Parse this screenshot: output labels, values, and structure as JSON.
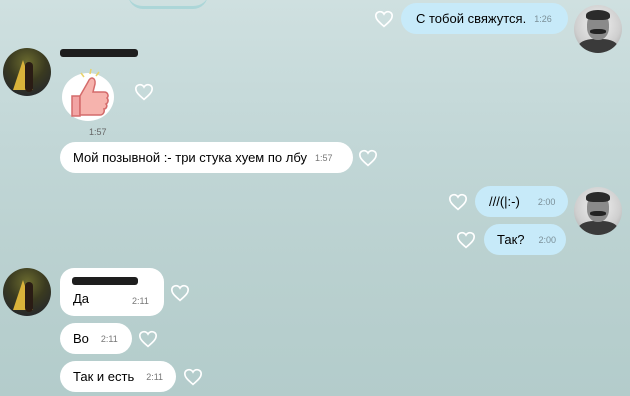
{
  "chat": {
    "messages": [
      {
        "text": "С тобой свяжутся.",
        "time": "1:26"
      },
      {
        "time": "1:57"
      },
      {
        "text": "Мой позывной :- три стука хуем по лбу",
        "time": "1:57"
      },
      {
        "text": "///(|:-)",
        "time": "2:00"
      },
      {
        "text": "Так?",
        "time": "2:00"
      },
      {
        "text": "Да",
        "time": "2:11"
      },
      {
        "text": "Во",
        "time": "2:11"
      },
      {
        "text": "Так и есть",
        "time": "2:11"
      }
    ]
  },
  "icons": {
    "like": "heart-outline-icon",
    "sticker": "thumbs-up-sticker"
  },
  "colors": {
    "incoming_bubble": "#ffffff",
    "outgoing_bubble": "#c7eaf9",
    "background": "#c2d7d7"
  }
}
